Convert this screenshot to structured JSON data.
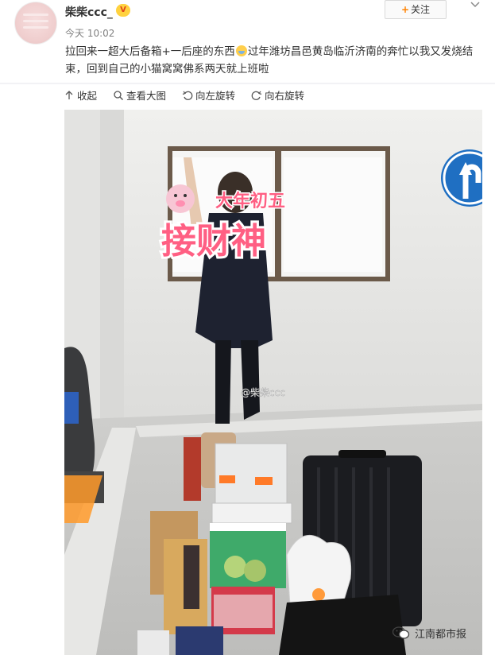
{
  "user": {
    "name": "柴柴ccc_",
    "timestamp": "今天 10:02"
  },
  "follow_button": {
    "plus": "+",
    "label": "关注"
  },
  "post": {
    "text_before_emoji": "拉回来一超大后备箱+一后座的东西",
    "text_after_emoji": "过年潍坊昌邑黄岛临沂济南的奔忙以我又发烧结束，回到自己的小猫窝窝佛系两天就上班啦",
    "emoji_icon": "sweat-emoji"
  },
  "toolbar": {
    "collapse": "收起",
    "view_large": "查看大图",
    "rotate_left": "向左旋转",
    "rotate_right": "向右旋转"
  },
  "photo": {
    "sticker_small": "大年初五",
    "sticker_big": "接财神",
    "weibo_watermark": "@柴柴ccc"
  },
  "source_watermark": "江南都市报",
  "colors": {
    "accent_orange": "#ff8200",
    "sticker_pink": "#ff6f8d",
    "sign_blue": "#1f6fc2"
  }
}
